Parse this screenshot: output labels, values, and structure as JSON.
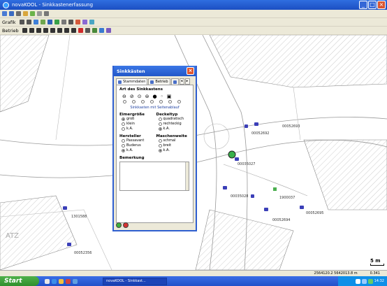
{
  "window": {
    "title": "novaKOOL - Sinkkastenerfassung"
  },
  "toolbars": {
    "row2_label": "Grafik",
    "row3_label": "Betrieb"
  },
  "map": {
    "plot_labels": [
      "00052693",
      "00052692",
      "00035027",
      "00035028",
      "1900037",
      "00052695",
      "00052694",
      "1301588",
      "00052356"
    ],
    "corner_text": "ATZ",
    "scale": "5 m"
  },
  "dialog": {
    "title": "Sinkkästen",
    "tabs": [
      "Stammdaten",
      "Betrieb"
    ],
    "type_section_title": "Art des Sinkkastens",
    "type_symbols": [
      "⊖",
      "⊘",
      "⊙",
      "⊜",
      "●",
      "◦",
      "▣"
    ],
    "link_text": "Sinkkasten mit Seitenablauf",
    "eimergroesse": {
      "title": "Eimergröße",
      "options": [
        "groß",
        "klein",
        "k.A."
      ],
      "selected": 0
    },
    "deckeltyp": {
      "title": "Deckeltyp",
      "options": [
        "quadratisch",
        "rechteckig",
        "k.A."
      ],
      "selected": 2
    },
    "hersteller": {
      "title": "Hersteller",
      "options": [
        "Passavant",
        "Buderus",
        "k.A."
      ],
      "selected": 2
    },
    "maschenweite": {
      "title": "Maschenweite",
      "options": [
        "schmal",
        "breit",
        "k.A."
      ],
      "selected": 2
    },
    "bemerkung_title": "Bemerkung"
  },
  "statusbar": {
    "coords": "2564120.2 5642013.8 m",
    "zoom": "0.341"
  },
  "taskbar": {
    "start": "Start",
    "task": "novaKOOL - Sinkkast...",
    "clock": "14:32"
  }
}
